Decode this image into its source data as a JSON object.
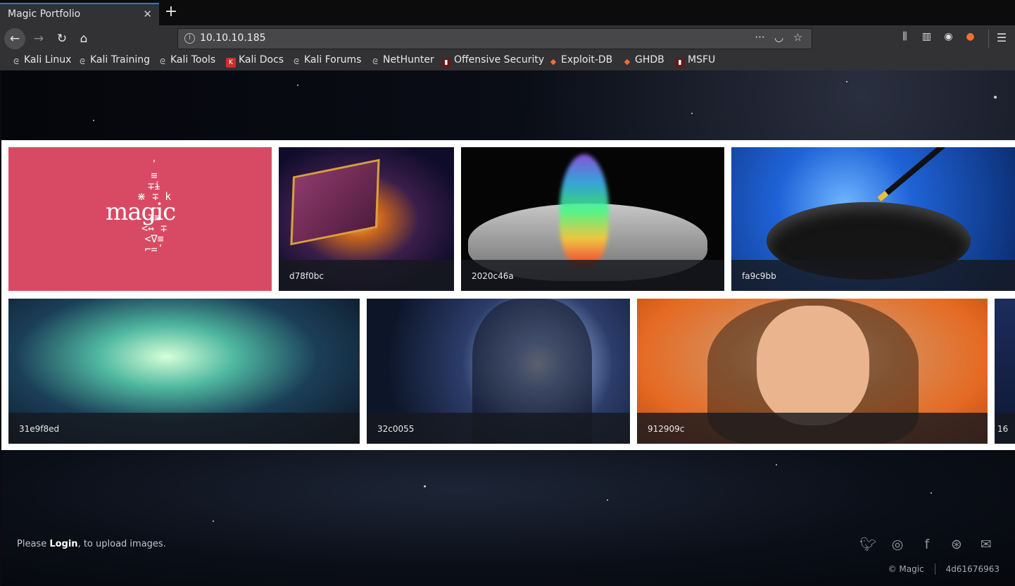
{
  "browser": {
    "tab_title": "Magic Portfolio",
    "tab_close": "✕",
    "new_tab": "+",
    "url": "10.10.10.185",
    "bookmarks": [
      {
        "label": "Kali Linux",
        "icon": "kali-dragon-icon"
      },
      {
        "label": "Kali Training",
        "icon": "kali-dragon-icon"
      },
      {
        "label": "Kali Tools",
        "icon": "kali-dragon-icon"
      },
      {
        "label": "Kali Docs",
        "icon": "kali-docs-icon"
      },
      {
        "label": "Kali Forums",
        "icon": "kali-dragon-icon"
      },
      {
        "label": "NetHunter",
        "icon": "nethunter-icon"
      },
      {
        "label": "Offensive Security",
        "icon": "offsec-icon"
      },
      {
        "label": "Exploit-DB",
        "icon": "exploitdb-icon"
      },
      {
        "label": "GHDB",
        "icon": "exploitdb-icon"
      },
      {
        "label": "MSFU",
        "icon": "offsec-icon"
      }
    ]
  },
  "gallery": {
    "items": [
      {
        "caption": "",
        "icon": "magic-logo-image"
      },
      {
        "caption": "d78f0bc",
        "icon": "magic-book-image"
      },
      {
        "caption": "2020c46a",
        "icon": "smoke-hand-image"
      },
      {
        "caption": "fa9c9bb",
        "icon": "magic-hat-image"
      },
      {
        "caption": "31e9f8ed",
        "icon": "light-swirl-image"
      },
      {
        "caption": "32c0055",
        "icon": "galaxy-hand-image"
      },
      {
        "caption": "912909c",
        "icon": "magic-man-image"
      },
      {
        "caption": "16",
        "icon": "partial-image"
      }
    ]
  },
  "footer": {
    "login_prefix": "Please ",
    "login_link": "Login",
    "login_suffix": ", to upload images.",
    "social": [
      "twitter-icon",
      "instagram-icon",
      "facebook-icon",
      "dribbble-icon",
      "email-icon"
    ],
    "copyright": "© Magic",
    "hash": "4d61676963"
  },
  "colors": {
    "accent_tab": "#0a84ff",
    "tile_pink": "#d84a64"
  }
}
